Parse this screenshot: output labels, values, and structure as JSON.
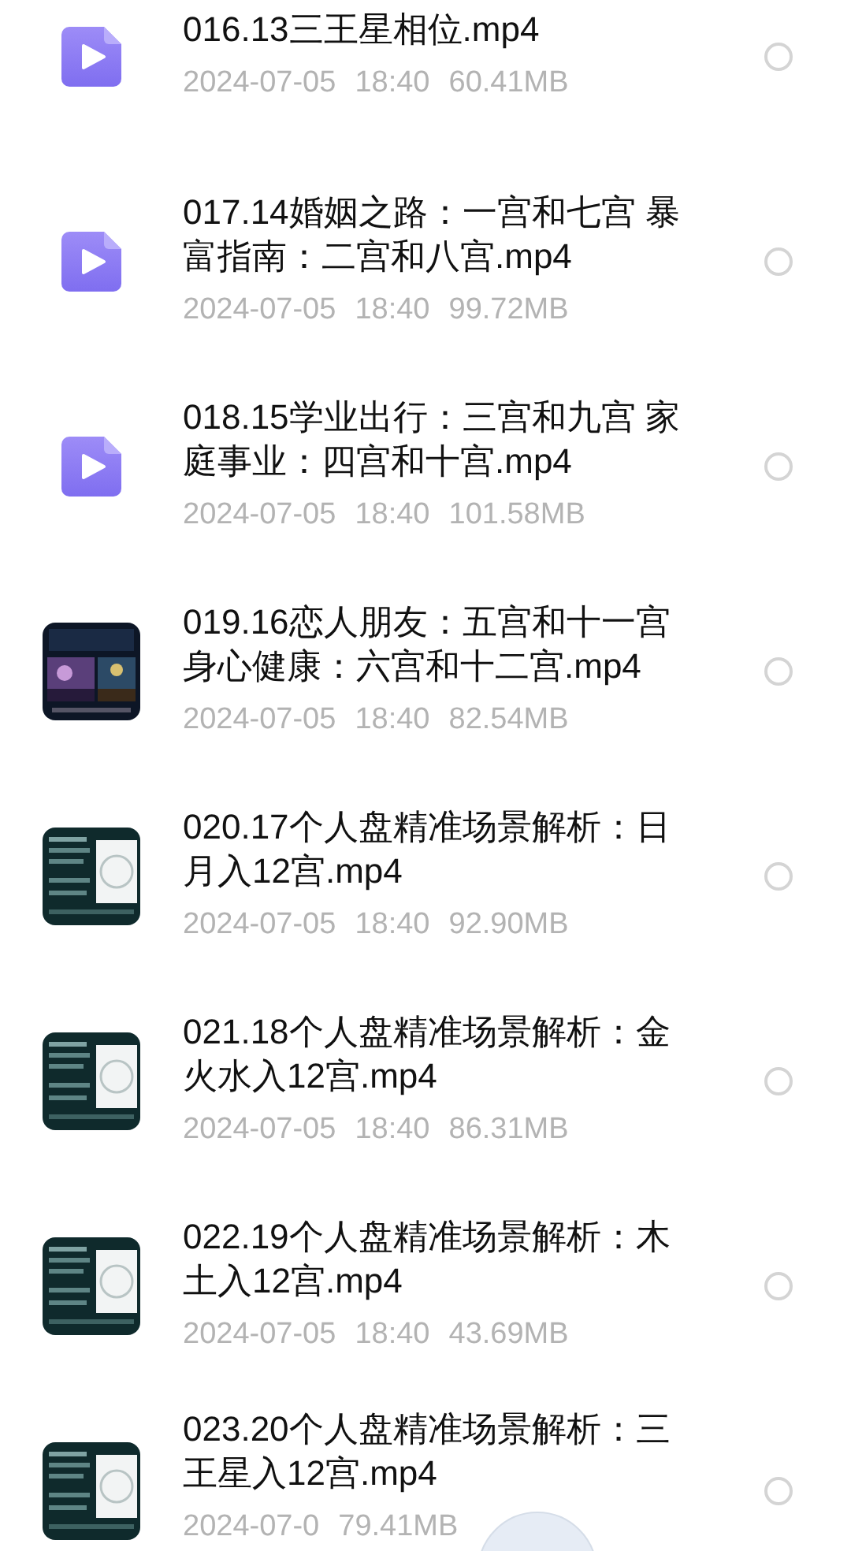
{
  "files": [
    {
      "name": "016.13三王星相位.mp4",
      "date": "2024-07-05",
      "time": "18:40",
      "size": "60.41MB",
      "thumb": {
        "kind": "video-icon"
      },
      "selected": false
    },
    {
      "name": "017.14婚姻之路：一宫和七宫 暴富指南：二宫和八宫.mp4",
      "date": "2024-07-05",
      "time": "18:40",
      "size": "99.72MB",
      "thumb": {
        "kind": "video-icon"
      },
      "selected": false
    },
    {
      "name": "018.15学业出行：三宫和九宫 家庭事业：四宫和十宫.mp4",
      "date": "2024-07-05",
      "time": "18:40",
      "size": "101.58MB",
      "thumb": {
        "kind": "video-icon"
      },
      "selected": false
    },
    {
      "name": "019.16恋人朋友：五宫和十一宫身心健康：六宫和十二宫.mp4",
      "date": "2024-07-05",
      "time": "18:40",
      "size": "82.54MB",
      "selected": false
    },
    {
      "name": "020.17个人盘精准场景解析：日月入12宫.mp4",
      "date": "2024-07-05",
      "time": "18:40",
      "size": "92.90MB",
      "selected": false
    },
    {
      "name": "021.18个人盘精准场景解析：金火水入12宫.mp4",
      "date": "2024-07-05",
      "time": "18:40",
      "size": "86.31MB",
      "selected": false
    },
    {
      "name": "022.19个人盘精准场景解析：木土入12宫.mp4",
      "date": "2024-07-05",
      "time": "18:40",
      "size": "43.69MB",
      "selected": false
    },
    {
      "name": "023.20个人盘精准场景解析：三王星入12宫.mp4",
      "date": "2024-07-0",
      "size": "79.41MB",
      "selected": false,
      "floating_ball": true
    }
  ]
}
